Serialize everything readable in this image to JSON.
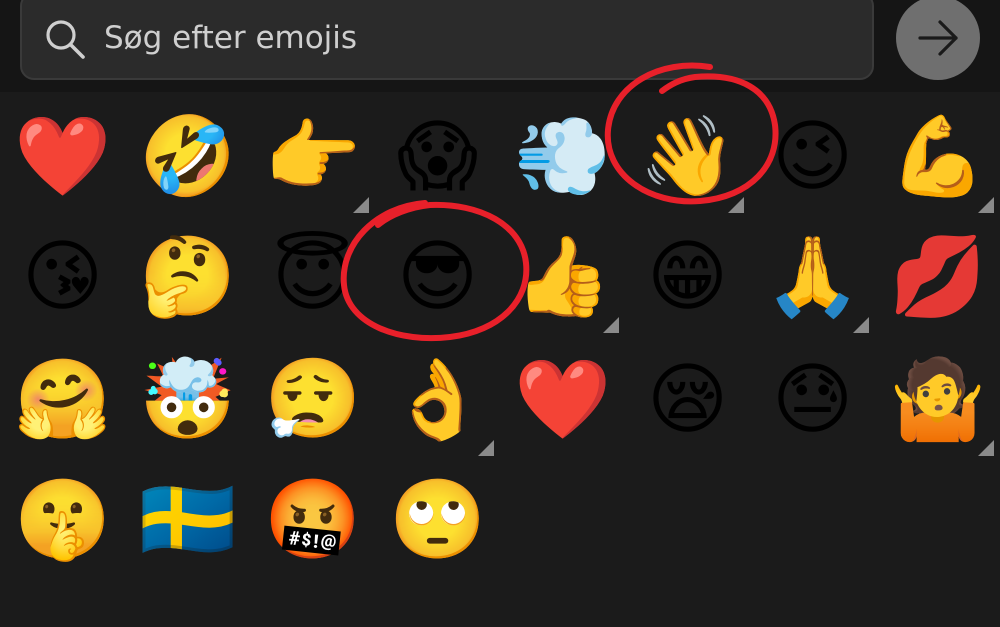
{
  "search": {
    "placeholder": "Søg efter emojis",
    "icon": "search-icon"
  },
  "go_button": {
    "icon": "arrow-right-icon"
  },
  "emoji_rows": [
    [
      {
        "char": "❤️",
        "name": "red-heart",
        "variants": false
      },
      {
        "char": "🤣",
        "name": "rolling-on-floor-laughing",
        "variants": false
      },
      {
        "char": "👉",
        "name": "pointing-right",
        "variants": true
      },
      {
        "char": "😱",
        "name": "screaming-in-fear",
        "variants": false
      },
      {
        "char": "💨",
        "name": "dashing-away",
        "variants": false
      },
      {
        "char": "👋",
        "name": "waving-hand",
        "variants": true
      },
      {
        "char": "😉",
        "name": "winking-face",
        "variants": false
      },
      {
        "char": "💪",
        "name": "flexed-biceps",
        "variants": true
      }
    ],
    [
      {
        "char": "😘",
        "name": "face-blowing-kiss",
        "variants": false
      },
      {
        "char": "🤔",
        "name": "thinking-face",
        "variants": false
      },
      {
        "char": "😇",
        "name": "smiling-face-with-halo",
        "variants": false
      },
      {
        "char": "😎",
        "name": "smiling-face-with-sunglasses",
        "variants": false
      },
      {
        "char": "👍",
        "name": "thumbs-up",
        "variants": true
      },
      {
        "char": "😁",
        "name": "beaming-face",
        "variants": false
      },
      {
        "char": "🙏",
        "name": "folded-hands",
        "variants": true
      },
      {
        "char": "💋",
        "name": "kiss-mark",
        "variants": false
      }
    ],
    [
      {
        "char": "🤗",
        "name": "hugging-face",
        "variants": false
      },
      {
        "char": "🤯",
        "name": "exploding-head",
        "variants": false
      },
      {
        "char": "😮‍💨",
        "name": "face-exhaling",
        "variants": false
      },
      {
        "char": "👌",
        "name": "ok-hand",
        "variants": true
      },
      {
        "char": "❤️",
        "name": "red-heart-2",
        "variants": false
      },
      {
        "char": "😪",
        "name": "sleepy-face",
        "variants": false
      },
      {
        "char": "😓",
        "name": "downcast-face-with-sweat",
        "variants": false
      },
      {
        "char": "🤷",
        "name": "person-shrugging",
        "variants": true
      }
    ],
    [
      {
        "char": "🤫",
        "name": "shushing-face",
        "variants": false
      },
      {
        "char": "🇸🇪",
        "name": "flag-sweden",
        "variants": false
      },
      {
        "char": "🤬",
        "name": "face-with-symbols-on-mouth",
        "variants": false
      },
      {
        "char": "🙄",
        "name": "face-with-rolling-eyes",
        "variants": false
      }
    ]
  ],
  "colors": {
    "background": "#1b1b1b",
    "annotation": "#e8202a",
    "variant_marker": "#8a8a8a"
  }
}
